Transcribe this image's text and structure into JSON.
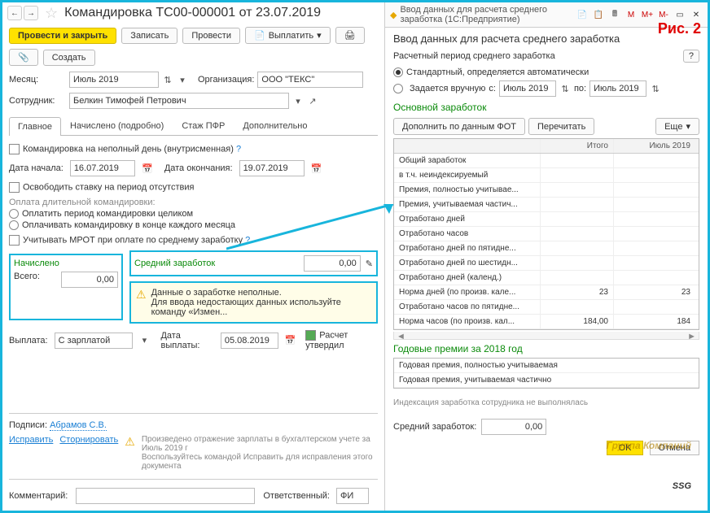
{
  "header": {
    "title": "Командировка ТС00-000001 от 23.07.2019"
  },
  "toolbar": {
    "save_close": "Провести и закрыть",
    "save": "Записать",
    "post": "Провести",
    "pay": "Выплатить",
    "create": "Создать"
  },
  "fields": {
    "month_l": "Месяц:",
    "month_v": "Июль 2019",
    "org_l": "Организация:",
    "org_v": "ООО \"ТЕКС\"",
    "emp_l": "Сотрудник:",
    "emp_v": "Белкин Тимофей Петрович"
  },
  "tabs": [
    "Главное",
    "Начислено (подробно)",
    "Стаж ПФР",
    "Дополнительно"
  ],
  "body": {
    "partial": "Командировка на неполный день (внутрисменная)",
    "start_l": "Дата начала:",
    "start_v": "16.07.2019",
    "end_l": "Дата окончания:",
    "end_v": "19.07.2019",
    "free": "Освободить ставку на период отсутствия",
    "long": "Оплата длительной командировки:",
    "r1": "Оплатить период командировки целиком",
    "r2": "Оплачивать командировку в конце каждого месяца",
    "mrot": "Учитывать МРОТ при оплате по среднему заработку",
    "acc": "Начислено",
    "avg": "Средний заработок",
    "total": "Всего:",
    "zero": "0,00",
    "warn1": "Данные о заработке неполные.",
    "warn2": "Для ввода недостающих данных используйте команду «Измен...",
    "pay_l": "Выплата:",
    "pay_v": "С зарплатой",
    "paydate_l": "Дата выплаты:",
    "paydate_v": "05.08.2019",
    "approved": "Расчет утвердил",
    "sign_l": "Подписи:",
    "sign_v": "Абрамов С.В.",
    "fix": "Исправить",
    "storno": "Сторнировать",
    "note": "Произведено отражение зарплаты в бухгалтерском учете за Июль 2019 г\nВоспользуйтесь командой Исправить для исправления этого документа",
    "comment_l": "Комментарий:",
    "resp_l": "Ответственный:",
    "resp_v": "ФИ"
  },
  "right": {
    "wintitle": "Ввод данных для расчета среднего заработка  (1С:Предприятие)",
    "ris": "Рис. 2",
    "title": "Ввод данных для расчета среднего заработка",
    "period": "Расчетный период среднего заработка",
    "auto": "Стандартный, определяется автоматически",
    "manual": "Задается вручную",
    "from": "с:",
    "to": "по:",
    "m": "Июль 2019",
    "main_sec": "Основной заработок",
    "fill": "Дополнить по данным ФОТ",
    "recalc": "Перечитать",
    "more": "Еще",
    "col_total": "Итого",
    "col_month": "Июль 2019",
    "rows": [
      {
        "n": "Общий заработок",
        "t": "",
        "m": ""
      },
      {
        "n": "    в т.ч. неиндексируемый",
        "t": "",
        "m": ""
      },
      {
        "n": "Премия, полностью учитывае...",
        "t": "",
        "m": ""
      },
      {
        "n": "Премия, учитываемая частич...",
        "t": "",
        "m": ""
      },
      {
        "n": "Отработано дней",
        "t": "",
        "m": ""
      },
      {
        "n": "Отработано часов",
        "t": "",
        "m": ""
      },
      {
        "n": "Отработано дней по пятидне...",
        "t": "",
        "m": ""
      },
      {
        "n": "Отработано дней по шестидн...",
        "t": "",
        "m": ""
      },
      {
        "n": "Отработано дней (календ.)",
        "t": "",
        "m": ""
      },
      {
        "n": "Норма дней (по произв. кале...",
        "t": "23",
        "m": "23"
      },
      {
        "n": "Отработано часов по пятидне...",
        "t": "",
        "m": ""
      },
      {
        "n": "Норма часов (по произв. кал...",
        "t": "184,00",
        "m": "184"
      }
    ],
    "year_sec": "Годовые премии за 2018 год",
    "y1": "Годовая премия, полностью учитываемая",
    "y2": "Годовая премия, учитываемая частично",
    "index": "Индексация заработка сотрудника не выполнялась",
    "avg_l": "Средний заработок:",
    "avg_v": "0,00",
    "ok": "OK",
    "cancel": "Отмена"
  },
  "ssg": {
    "top": "Группа Компаний",
    "main": "SSG"
  }
}
